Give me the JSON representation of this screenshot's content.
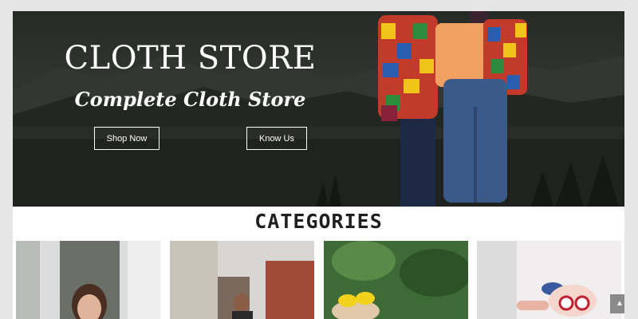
{
  "hero": {
    "title": "CLOTH STORE",
    "subtitle": "Complete Cloth Store",
    "shop_button": "Shop Now",
    "know_button": "Know Us"
  },
  "categories": {
    "heading": "CATEGORIES",
    "cards": [
      {
        "image": "woman-portrait-photo"
      },
      {
        "image": "man-street-photo"
      },
      {
        "image": "child-yellow-bow-photo"
      },
      {
        "image": "child-sunglasses-photo"
      }
    ]
  },
  "scroll_top": {
    "icon": "chevron-up-icon",
    "glyph": "▲"
  },
  "colors": {
    "hero_bg": "#2e342e",
    "page_bg": "#e6e6e6",
    "heading": "#1f1f1f",
    "scroll_button": "#8a8a8a"
  }
}
